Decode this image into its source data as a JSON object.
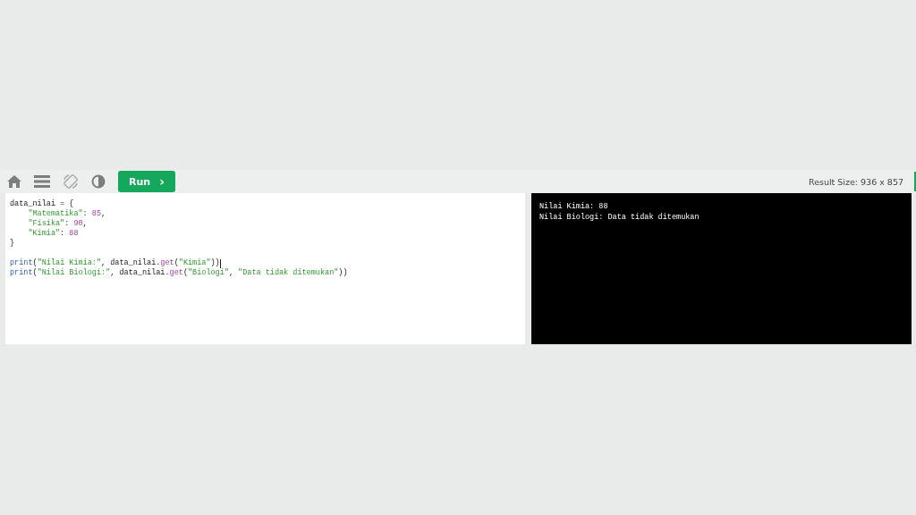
{
  "toolbar": {
    "run_button": {
      "label": "Run",
      "caret": "›"
    },
    "result_size": "Result Size: 936 x 857"
  },
  "editor": {
    "lines": [
      {
        "kind": "code",
        "indented": false,
        "cursor": false,
        "tokens": [
          {
            "kind": "plain",
            "text": "data_nilai = {"
          }
        ]
      },
      {
        "kind": "code",
        "indented": true,
        "cursor": false,
        "tokens": [
          {
            "kind": "string",
            "text": "\"Matematika\""
          },
          {
            "kind": "plain",
            "text": ": "
          },
          {
            "kind": "number",
            "text": "85"
          },
          {
            "kind": "plain",
            "text": ","
          }
        ]
      },
      {
        "kind": "code",
        "indented": true,
        "cursor": false,
        "tokens": [
          {
            "kind": "string",
            "text": "\"Fisika\""
          },
          {
            "kind": "plain",
            "text": ": "
          },
          {
            "kind": "number",
            "text": "90"
          },
          {
            "kind": "plain",
            "text": ","
          }
        ]
      },
      {
        "kind": "code",
        "indented": true,
        "cursor": false,
        "tokens": [
          {
            "kind": "string",
            "text": "\"Kimia\""
          },
          {
            "kind": "plain",
            "text": ": "
          },
          {
            "kind": "number",
            "text": "88"
          }
        ]
      },
      {
        "kind": "code",
        "indented": false,
        "cursor": false,
        "tokens": [
          {
            "kind": "plain",
            "text": "}"
          }
        ]
      },
      {
        "kind": "blank"
      },
      {
        "kind": "code",
        "indented": false,
        "cursor": true,
        "tokens": [
          {
            "kind": "builtin",
            "text": "print"
          },
          {
            "kind": "plain",
            "text": "("
          },
          {
            "kind": "string",
            "text": "\"Nilai Kimia:\""
          },
          {
            "kind": "plain",
            "text": ", data_nilai."
          },
          {
            "kind": "method",
            "text": "get"
          },
          {
            "kind": "plain",
            "text": "("
          },
          {
            "kind": "string",
            "text": "\"Kimia\""
          },
          {
            "kind": "plain",
            "text": "))"
          }
        ]
      },
      {
        "kind": "code",
        "indented": false,
        "cursor": false,
        "tokens": [
          {
            "kind": "builtin",
            "text": "print"
          },
          {
            "kind": "plain",
            "text": "("
          },
          {
            "kind": "string",
            "text": "\"Nilai Biologi:\""
          },
          {
            "kind": "plain",
            "text": ", data_nilai."
          },
          {
            "kind": "method",
            "text": "get"
          },
          {
            "kind": "plain",
            "text": "("
          },
          {
            "kind": "string",
            "text": "\"Biologi\""
          },
          {
            "kind": "plain",
            "text": ", "
          },
          {
            "kind": "string",
            "text": "\"Data tidak ditemukan\""
          },
          {
            "kind": "plain",
            "text": "))"
          }
        ]
      }
    ]
  },
  "output": {
    "lines": [
      "Nilai Kimia: 88",
      "Nilai Biologi: Data tidak ditemukan"
    ]
  }
}
